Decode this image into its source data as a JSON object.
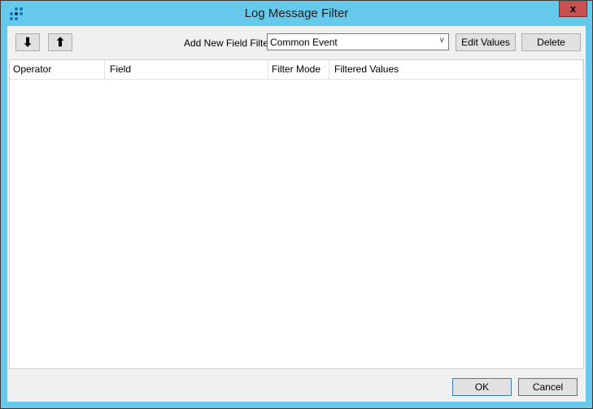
{
  "window": {
    "title": "Log Message Filter",
    "close_label": "x"
  },
  "toolbar": {
    "move_down_icon": "arrow-down",
    "move_down_glyph": "🠗",
    "move_up_icon": "arrow-up",
    "move_up_glyph": "🠕",
    "add_filter_label": "Add New Field Filter:",
    "add_filter_value": "Common Event",
    "combo_arrow": "⌄",
    "edit_values_label": "Edit Values",
    "delete_label": "Delete"
  },
  "grid": {
    "columns": [
      "Operator",
      "Field",
      "Filter Mode",
      "Filtered Values"
    ],
    "rows": []
  },
  "footer": {
    "ok_label": "OK",
    "cancel_label": "Cancel"
  }
}
